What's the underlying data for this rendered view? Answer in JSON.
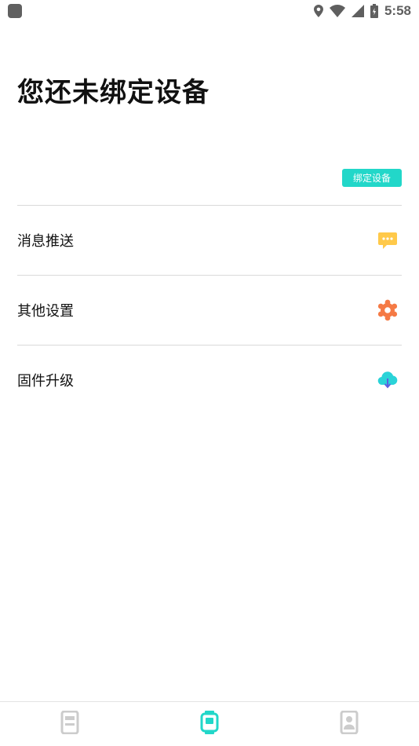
{
  "status_bar": {
    "time": "5:58",
    "icons": [
      "app-notification-icon",
      "location-icon",
      "wifi-icon",
      "signal-icon",
      "battery-icon"
    ]
  },
  "page": {
    "title": "您还未绑定设备"
  },
  "bind_button": {
    "label": "绑定设备",
    "color": "#22d7c9"
  },
  "menu": {
    "items": [
      {
        "label": "消息推送",
        "icon": "message-bubble-icon",
        "color": "#ffc94a"
      },
      {
        "label": "其他设置",
        "icon": "settings-gear-icon",
        "color": "#f57a45"
      },
      {
        "label": "固件升级",
        "icon": "cloud-download-icon",
        "color": "#2ad3d8"
      }
    ]
  },
  "bottom_nav": {
    "tabs": [
      {
        "icon": "device-list-icon",
        "active": false
      },
      {
        "icon": "watch-icon",
        "active": true
      },
      {
        "icon": "profile-icon",
        "active": false
      }
    ],
    "active_color": "#22d7c9",
    "inactive_color": "#cccccc"
  }
}
